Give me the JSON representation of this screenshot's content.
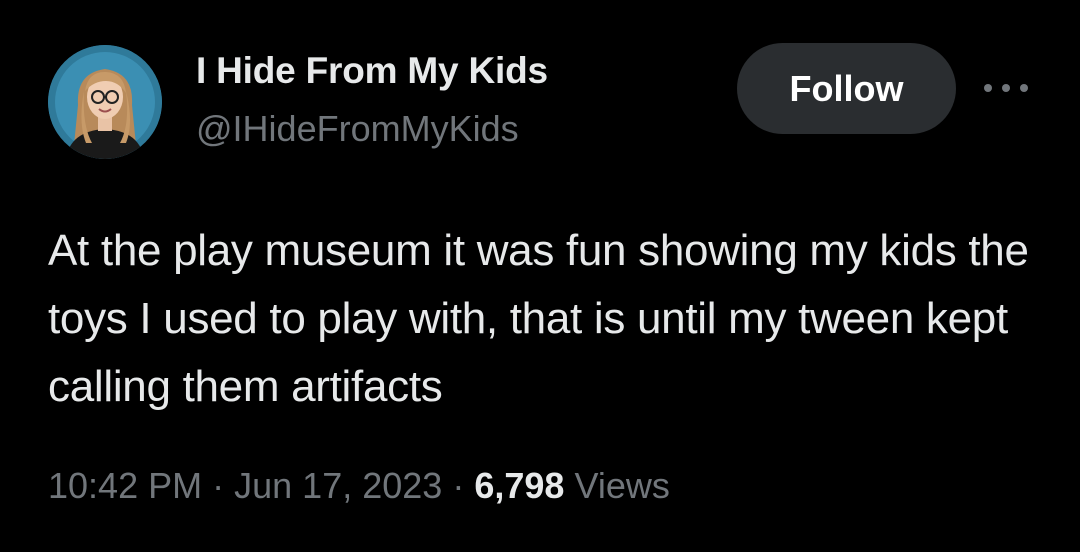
{
  "author": {
    "display_name": "I Hide From My Kids",
    "handle": "@IHideFromMyKids"
  },
  "actions": {
    "follow_label": "Follow",
    "more_icon": "ellipsis-horizontal-icon"
  },
  "tweet": {
    "text": "At the play museum it was fun showing my kids the toys I used to play with, that is until my tween kept calling them artifacts"
  },
  "meta": {
    "time": "10:42 PM",
    "separator": "·",
    "date": "Jun 17, 2023",
    "views_count": "6,798",
    "views_label": "Views"
  },
  "colors": {
    "background": "#000000",
    "primary_text": "#e7e9ea",
    "secondary_text": "#71767b",
    "follow_button_bg": "#2a2d30",
    "avatar_bg": "#2f7a9a"
  }
}
